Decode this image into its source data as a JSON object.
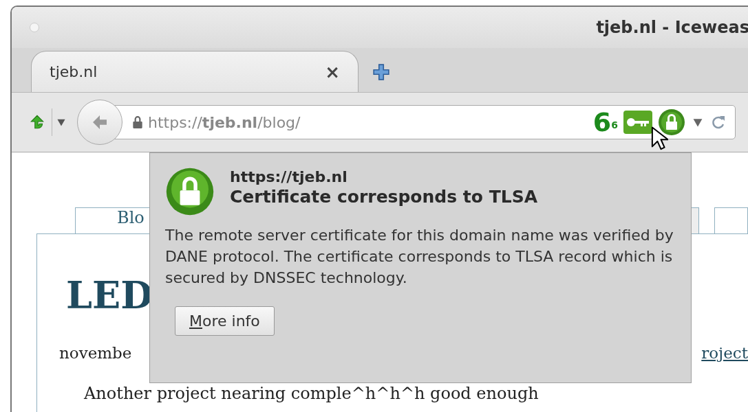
{
  "window": {
    "title": "tjeb.nl - Iceweas"
  },
  "tabs": [
    {
      "label": "tjeb.nl",
      "selected": true,
      "close": "×"
    }
  ],
  "toolbar": {
    "url": "https://**tjeb.nl**/blog/",
    "dnssec_count": "6",
    "dnssec_sub": "6"
  },
  "page": {
    "menu_tabs": [
      {
        "label": "Blo",
        "selected": false
      },
      {
        "selected": true
      },
      {
        "selected": false
      }
    ],
    "heading": "LED",
    "date": "novembe",
    "link": "roject",
    "paragraph": "Another project nearing comple^h^h^h good enough"
  },
  "popup": {
    "origin": "https://tjeb.nl",
    "heading": "Certificate corresponds to TLSA",
    "body": "The remote server certificate for this domain name was verified by DANE protocol. The certificate corresponds to TLSA record which is secured by DNSSEC technology.",
    "button": "More info"
  }
}
